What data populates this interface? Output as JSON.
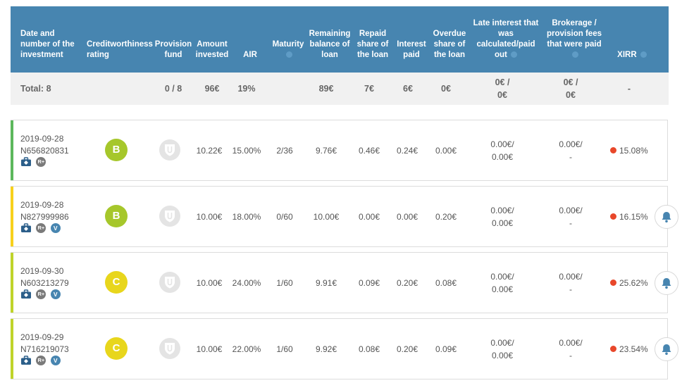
{
  "header": {
    "date_number": "Date and number of the investment",
    "rating": "Creditworthiness rating",
    "provision_fund": "Provision fund",
    "amount_invested": "Amount invested",
    "air": "AIR",
    "maturity": "Maturity",
    "remaining_balance": "Remaining balance of loan",
    "repaid_share": "Repaid share of the loan",
    "interest_paid": "Interest paid",
    "overdue_share": "Overdue share of the loan",
    "late_interest": "Late interest that was calculated/paid out",
    "brokerage_fees": "Brokerage / provision fees that were paid",
    "xirr": "XIRR"
  },
  "totals": {
    "label": "Total: 8",
    "provision_fund": "0 / 8",
    "amount_invested": "96€",
    "air": "19%",
    "remaining_balance": "89€",
    "repaid_share": "7€",
    "interest_paid": "6€",
    "overdue_share": "0€",
    "late_interest_1": "0€ /",
    "late_interest_2": "0€",
    "brokerage_1": "0€ /",
    "brokerage_2": "0€",
    "xirr": "-"
  },
  "rows": [
    {
      "date": "2019-09-28",
      "number": "N656820831",
      "rating": "B",
      "amount": "10.22€",
      "air": "15.00%",
      "maturity": "2/36",
      "remaining": "9.76€",
      "repaid": "0.46€",
      "interest": "0.24€",
      "overdue": "0.00€",
      "late_1": "0.00€/",
      "late_2": "0.00€",
      "brok_1": "0.00€/",
      "brok_2": "-",
      "xirr": "15.08%",
      "icon_v": "",
      "bell": false,
      "stripe": "#5cb85c",
      "rating_color": "#a6c72b"
    },
    {
      "date": "2019-09-28",
      "number": "N827999986",
      "rating": "B",
      "amount": "10.00€",
      "air": "18.00%",
      "maturity": "0/60",
      "remaining": "10.00€",
      "repaid": "0.00€",
      "interest": "0.00€",
      "overdue": "0.20€",
      "late_1": "0.00€/",
      "late_2": "0.00€",
      "brok_1": "0.00€/",
      "brok_2": "-",
      "xirr": "16.15%",
      "icon_v": "V",
      "bell": true,
      "stripe": "#f7d01c",
      "rating_color": "#a6c72b"
    },
    {
      "date": "2019-09-30",
      "number": "N603213279",
      "rating": "C",
      "amount": "10.00€",
      "air": "24.00%",
      "maturity": "1/60",
      "remaining": "9.91€",
      "repaid": "0.09€",
      "interest": "0.20€",
      "overdue": "0.08€",
      "late_1": "0.00€/",
      "late_2": "0.00€",
      "brok_1": "0.00€/",
      "brok_2": "-",
      "xirr": "25.62%",
      "icon_v": "V",
      "bell": true,
      "stripe": "#bfd32a",
      "rating_color": "#e8d61c"
    },
    {
      "date": "2019-09-29",
      "number": "N716219073",
      "rating": "C",
      "amount": "10.00€",
      "air": "22.00%",
      "maturity": "1/60",
      "remaining": "9.92€",
      "repaid": "0.08€",
      "interest": "0.20€",
      "overdue": "0.09€",
      "late_1": "0.00€/",
      "late_2": "0.00€",
      "brok_1": "0.00€/",
      "brok_2": "-",
      "xirr": "23.54%",
      "icon_v": "V",
      "bell": true,
      "stripe": "#bfd32a",
      "rating_color": "#e8d61c"
    }
  ],
  "icon_names": {
    "briefcase": "briefcase-icon",
    "rplus": "R+",
    "provision": "shield-icon",
    "bell": "bell-icon",
    "xirr_status": "status-dot-icon"
  },
  "colors": {
    "header_bg": "#4785b0",
    "total_bg": "#f1f1f1",
    "xirr_dot": "#e8472a"
  }
}
